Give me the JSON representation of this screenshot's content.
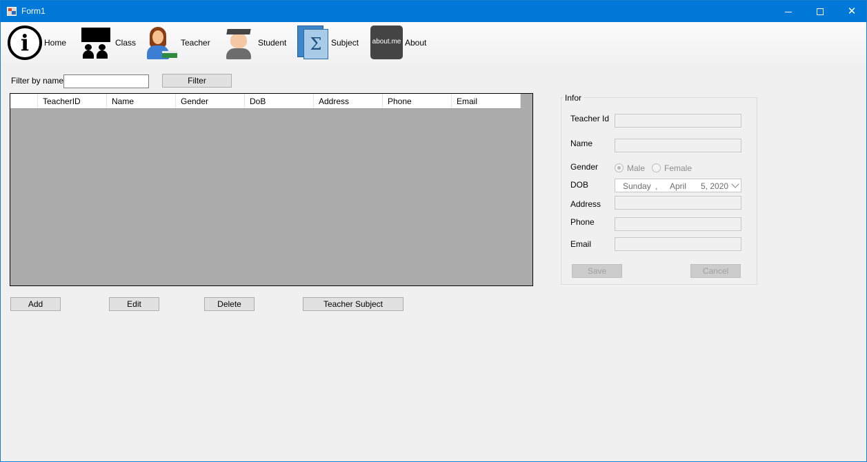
{
  "window": {
    "title": "Form1"
  },
  "menu": {
    "items": [
      {
        "label": "Home",
        "icon": "info-icon"
      },
      {
        "label": "Class",
        "icon": "classroom-icon"
      },
      {
        "label": "Teacher",
        "icon": "teacher-icon"
      },
      {
        "label": "Student",
        "icon": "student-icon"
      },
      {
        "label": "Subject",
        "icon": "subject-icon"
      },
      {
        "label": "About",
        "icon": "about-me-icon",
        "icon_text": "about.me"
      }
    ]
  },
  "filter": {
    "label": "Filter by name",
    "value": "",
    "button": "Filter"
  },
  "grid": {
    "columns": [
      "TeacherID",
      "Name",
      "Gender",
      "DoB",
      "Address",
      "Phone",
      "Email"
    ],
    "rows": []
  },
  "actions": {
    "add": "Add",
    "edit": "Edit",
    "delete": "Delete",
    "teacher_subject": "Teacher Subject"
  },
  "info": {
    "group_title": "Infor",
    "teacher_id_label": "Teacher Id",
    "name_label": "Name",
    "gender_label": "Gender",
    "gender_options": [
      "Male",
      "Female"
    ],
    "gender_selected": "Male",
    "dob_label": "DOB",
    "dob": {
      "weekday": "Sunday",
      "sep": ",",
      "month": "April",
      "day_year": "5, 2020"
    },
    "address_label": "Address",
    "phone_label": "Phone",
    "email_label": "Email",
    "save": "Save",
    "cancel": "Cancel"
  },
  "colors": {
    "titlebar": "#0078d7",
    "grid_background": "#ababab"
  }
}
